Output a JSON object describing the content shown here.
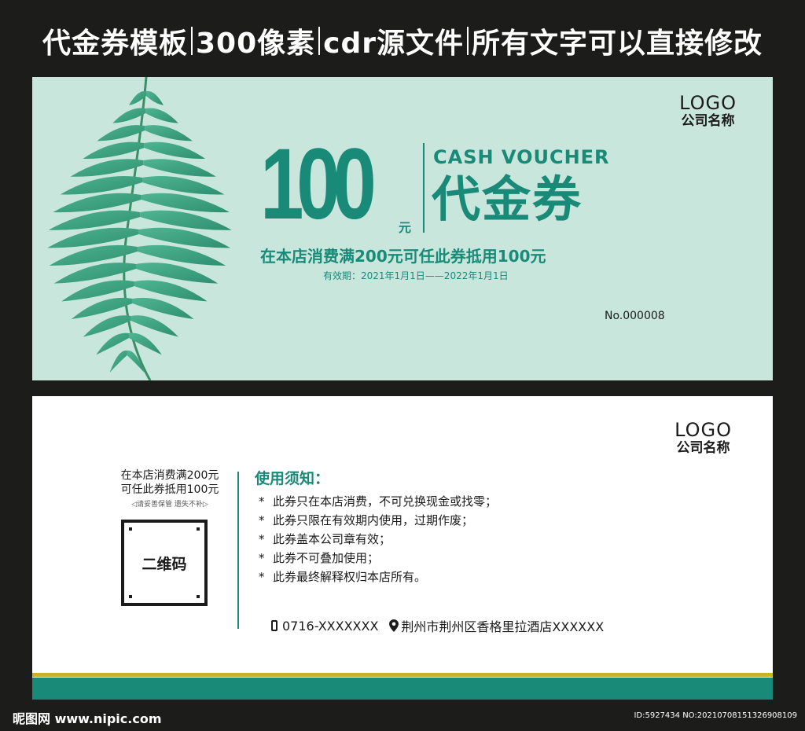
{
  "banner": {
    "part1": "代金券模板",
    "part2": "300像素",
    "part3": "cdr源文件",
    "part4": "所有文字可以直接修改"
  },
  "front": {
    "logo": "LOGO",
    "company": "公司名称",
    "amount": "100",
    "unit": "元",
    "cash_en": "CASH VOUCHER",
    "cash_cn": "代金券",
    "offer": "在本店消费满200元可任此券抵用100元",
    "validity": "有效期：2021年1月1日——2022年1月1日",
    "serial": "No.000008"
  },
  "back": {
    "logo": "LOGO",
    "company": "公司名称",
    "offer_line1": "在本店消费满200元",
    "offer_line2": "可任此券抵用100元",
    "keep_note": "◁请妥善保管  遗失不补▷",
    "qr_label": "二维码",
    "notice_title": "使用须知：",
    "notices": [
      "此券只在本店消费，不可兑换现金或找零；",
      "此券只限在有效期内使用，过期作废；",
      "此券盖本公司章有效；",
      "此券不可叠加使用；",
      "此券最终解释权归本店所有。"
    ],
    "bullet": "*",
    "phone": "0716-XXXXXXX",
    "address": "荆州市荆州区香格里拉酒店XXXXXX"
  },
  "footer": {
    "site": "昵图网 www.nipic.com",
    "id_text": "ID:5927434 NO:20210708151326908109"
  },
  "colors": {
    "teal": "#1a8a78",
    "mint": "#c8e6dc",
    "gold": "#c7b22b",
    "dark": "#1c1c1b"
  }
}
